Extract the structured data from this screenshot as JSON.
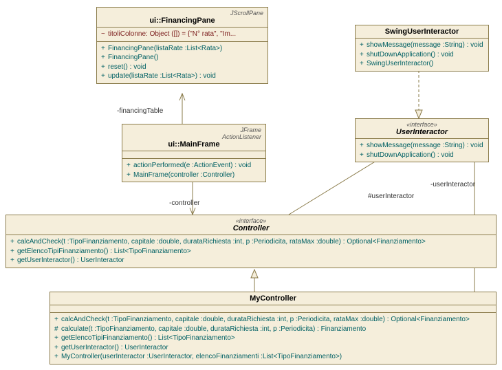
{
  "classes": {
    "financingPane": {
      "stereo": "JScrollPane",
      "name": "ui::FinancingPane",
      "attrs": [
        {
          "vis": "~",
          "text": "titoliColonne:  Object ([]) = {\"N° rata\", \"Im..."
        }
      ],
      "ops": [
        {
          "vis": "+",
          "text": "FinancingPane(listaRate :List<Rata>)"
        },
        {
          "vis": "+",
          "text": "FinancingPane()"
        },
        {
          "vis": "+",
          "text": "reset() : void"
        },
        {
          "vis": "+",
          "text": "update(listaRate :List<Rata>) : void"
        }
      ]
    },
    "mainFrame": {
      "stereo1": "JFrame",
      "stereo2": "ActionListener",
      "name": "ui::MainFrame",
      "ops": [
        {
          "vis": "+",
          "text": "actionPerformed(e :ActionEvent) : void"
        },
        {
          "vis": "+",
          "text": "MainFrame(controller :Controller)"
        }
      ]
    },
    "swingUserInteractor": {
      "name": "SwingUserInteractor",
      "ops": [
        {
          "vis": "+",
          "text": "showMessage(message :String) : void"
        },
        {
          "vis": "+",
          "text": "shutDownApplication() : void"
        },
        {
          "vis": "+",
          "text": "SwingUserInteractor()"
        }
      ]
    },
    "userInteractor": {
      "stereo": "«interface»",
      "name": "UserInteractor",
      "ops": [
        {
          "vis": "+",
          "text": "showMessage(message :String) : void"
        },
        {
          "vis": "+",
          "text": "shutDownApplication() : void"
        }
      ]
    },
    "controller": {
      "stereo": "«interface»",
      "name": "Controller",
      "ops": [
        {
          "vis": "+",
          "text": "calcAndCheck(t :TipoFinanziamento, capitale :double, durataRichiesta :int, p :Periodicita, rataMax :double) : Optional<Finanziamento>"
        },
        {
          "vis": "+",
          "text": "getElencoTipiFinanziamento() : List<TipoFinanziamento>"
        },
        {
          "vis": "+",
          "text": "getUserInteractor() : UserInteractor"
        }
      ]
    },
    "myController": {
      "name": "MyController",
      "ops": [
        {
          "vis": "+",
          "text": "calcAndCheck(t :TipoFinanziamento, capitale :double, durataRichiesta :int, p :Periodicita, rataMax :double) : Optional<Finanziamento>"
        },
        {
          "vis": "#",
          "text": "calculate(t :TipoFinanziamento, capitale :double, durataRichiesta :int, p :Periodicita) : Finanziamento"
        },
        {
          "vis": "+",
          "text": "getElencoTipiFinanziamento() : List<TipoFinanziamento>"
        },
        {
          "vis": "+",
          "text": "getUserInteractor() : UserInteractor"
        },
        {
          "vis": "+",
          "text": "MyController(userInteractor :UserInteractor, elencoFinanziamenti :List<TipoFinanziamento>)"
        }
      ]
    }
  },
  "labels": {
    "financingTable": "-financingTable",
    "controller": "-controller",
    "userInteractorHash": "#userInteractor",
    "userInteractorDash": "-userInteractor"
  }
}
